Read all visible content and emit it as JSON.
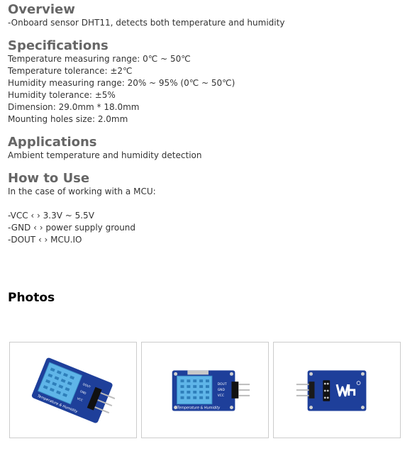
{
  "overview": {
    "heading": "Overview",
    "lines": [
      "-Onboard sensor DHT11, detects both temperature and humidity"
    ]
  },
  "specifications": {
    "heading": "Specifications",
    "lines": [
      "Temperature measuring range: 0℃ ~ 50℃",
      "Temperature tolerance: ±2℃",
      "Humidity measuring range: 20% ~ 95% (0℃ ~ 50℃)",
      "Humidity tolerance: ±5%",
      "Dimension: 29.0mm * 18.0mm",
      "Mounting holes size: 2.0mm"
    ]
  },
  "applications": {
    "heading": "Applications",
    "lines": [
      "Ambient temperature and humidity detection"
    ]
  },
  "how_to_use": {
    "heading": "How to Use",
    "intro": "In the case of working with a MCU:",
    "pins": [
      "-VCC ‹ › 3.3V ~ 5.5V",
      "-GND ‹ › power supply ground",
      "-DOUT ‹ › MCU.IO"
    ]
  },
  "photos": {
    "heading": "Photos",
    "items": [
      {
        "board_label": "Temperature & Humidity",
        "pin_labels": [
          "DOUT",
          "GND",
          "VCC"
        ]
      },
      {
        "board_label": "Temperature & Humidity",
        "pin_labels": [
          "DOUT",
          "GND",
          "VCC"
        ]
      },
      {
        "board_label": "",
        "pin_labels": []
      }
    ]
  },
  "colors": {
    "board_blue": "#1e3f9a",
    "sensor_cyan": "#5fb5e8",
    "heading_gray": "#666666"
  }
}
